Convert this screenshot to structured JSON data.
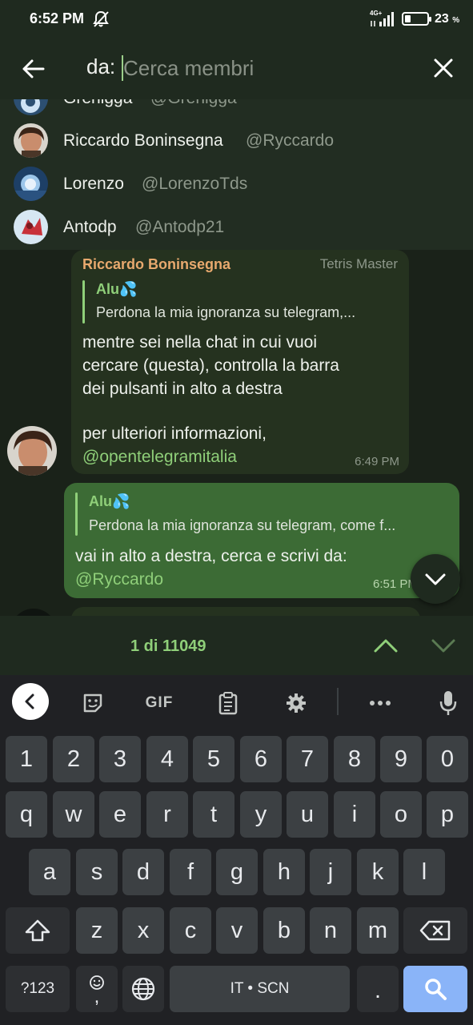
{
  "status_bar": {
    "time": "6:52 PM",
    "network": "4G+",
    "battery_pct": "23",
    "battery_unit": "%"
  },
  "search": {
    "prefix": "da:",
    "placeholder": "Cerca membri"
  },
  "members": [
    {
      "name": "Grenigga",
      "handle": "@Grenigga"
    },
    {
      "name": "Riccardo Boninsegna",
      "handle": "@Ryccardo"
    },
    {
      "name": "Lorenzo",
      "handle": "@LorenzoTds"
    },
    {
      "name": "Antodp",
      "handle": "@Antodp21"
    }
  ],
  "messages": {
    "incoming": {
      "sender": "Riccardo Boninsegna",
      "badge": "Tetris Master",
      "reply_name": "Alu💦",
      "reply_text": "Perdona la mia ignoranza su telegram,...",
      "text_line1": "mentre sei nella chat in cui vuoi",
      "text_line2": "cercare (questa), controlla la barra",
      "text_line3": "dei pulsanti in alto a destra",
      "text_line4": "per ulteriori informazioni,",
      "link": "@opentelegramitalia",
      "time": "6:49 PM"
    },
    "outgoing": {
      "reply_name": "Alu💦",
      "reply_text": "Perdona la mia ignoranza su telegram, come f...",
      "text": "vai in alto a destra, cerca e scrivi da:",
      "link": "@Ryccardo",
      "time": "6:51 PM"
    }
  },
  "results": {
    "count": "1 di 11049"
  },
  "keyboard": {
    "toolbar": [
      "back-icon",
      "sticker-icon",
      "GIF",
      "clipboard-icon",
      "gear-icon",
      "more-icon",
      "mic-icon"
    ],
    "gif_label": "GIF",
    "row_numbers": [
      "1",
      "2",
      "3",
      "4",
      "5",
      "6",
      "7",
      "8",
      "9",
      "0"
    ],
    "row1": [
      "q",
      "w",
      "e",
      "r",
      "t",
      "y",
      "u",
      "i",
      "o",
      "p"
    ],
    "row2": [
      "a",
      "s",
      "d",
      "f",
      "g",
      "h",
      "j",
      "k",
      "l"
    ],
    "row3": [
      "z",
      "x",
      "c",
      "v",
      "b",
      "n",
      "m"
    ],
    "sym_label": "?123",
    "comma_label": ",",
    "space_label": "IT • SCN",
    "period_label": "."
  },
  "colors": {
    "accent_green": "#8fcf79",
    "outgoing_bubble": "#3c6b35",
    "incoming_bubble": "#25321f",
    "sender_name": "#e8a96e",
    "search_key": "#8ab4f8"
  }
}
